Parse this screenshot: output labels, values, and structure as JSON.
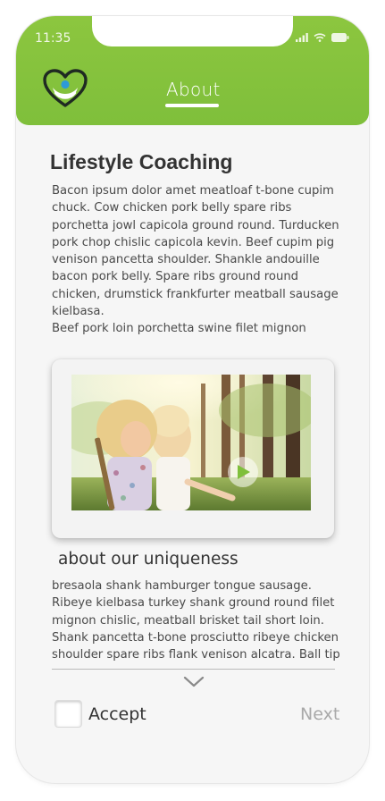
{
  "status_bar": {
    "time": "11:35"
  },
  "header": {
    "logo_icon": "heart-hands-logo-icon",
    "nav": {
      "about_label": "About"
    },
    "accent_color": "#8cc63f"
  },
  "main": {
    "title": "Lifestyle Coaching",
    "paragraph_1": "Bacon ipsum dolor amet meatloaf t-bone cupim chuck. Cow chicken pork belly spare ribs porchetta jowl capicola ground round. Turducken pork chop chislic capicola kevin. Beef cupim pig venison pancetta shoulder. Shankle andouille bacon pork belly. Spare ribs ground round chicken, drumstick frankfurter meatball sausage kielbasa.\nBeef pork loin porchetta swine filet mignon",
    "video": {
      "play_icon": "play-icon"
    },
    "subtitle": "about our uniqueness",
    "paragraph_2": "bresaola shank hamburger tongue sausage. Ribeye kielbasa turkey shank ground round filet mignon chislic, meatball brisket tail short loin. Shank pancetta t-bone prosciutto ribeye chicken shoulder spare ribs flank venison alcatra. Ball tip"
  },
  "footer": {
    "accept_label": "Accept",
    "next_label": "Next",
    "scroll_icon": "chevron-down-icon"
  }
}
